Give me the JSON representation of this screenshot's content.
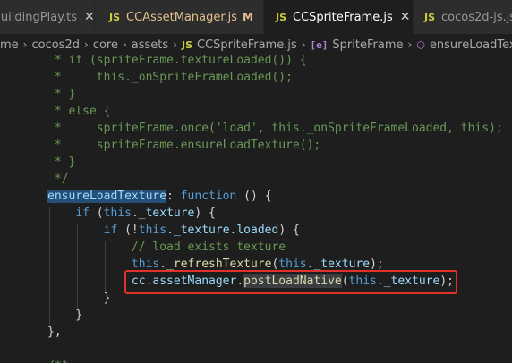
{
  "tabs": [
    {
      "icon": "TS",
      "icon_kind": "ts",
      "label": "BuildingPlay.ts",
      "closable": true,
      "active": false,
      "modified": false
    },
    {
      "icon": "JS",
      "icon_kind": "js",
      "label": "CCAssetManager.js",
      "mod_marker": "M",
      "active": false,
      "modified": true
    },
    {
      "icon": "JS",
      "icon_kind": "js",
      "label": "CCSpriteFrame.js",
      "closable": true,
      "active": true,
      "modified": false
    },
    {
      "icon": "JS",
      "icon_kind": "js",
      "label": "cocos2d-js.js",
      "active": false,
      "modified": false
    }
  ],
  "breadcrumb": {
    "items": [
      "me",
      "cocos2d",
      "core",
      "assets",
      "CCSpriteFrame.js",
      "SpriteFrame",
      "ensureLoadTexture"
    ],
    "file_icon": "JS",
    "class_icon": "[e]",
    "method_icon": "⬡"
  },
  "code_lines": [
    [
      [
        "c",
        " * if (spriteFrame.textureLoaded()) {"
      ]
    ],
    [
      [
        "c",
        " *     this._onSpriteFrameLoaded();"
      ]
    ],
    [
      [
        "c",
        " * }"
      ]
    ],
    [
      [
        "c",
        " * else {"
      ]
    ],
    [
      [
        "c",
        " *     spriteFrame.once('load', this._onSpriteFrameLoaded, this);"
      ]
    ],
    [
      [
        "c",
        " *     spriteFrame.ensureLoadTexture();"
      ]
    ],
    [
      [
        "c",
        " * }"
      ]
    ],
    [
      [
        "c",
        " */"
      ]
    ],
    [
      [
        "v",
        "ensureLoadTexture"
      ],
      [
        "p",
        ": "
      ],
      [
        "k",
        "function"
      ],
      [
        "p",
        " () {"
      ]
    ],
    [
      [
        "p",
        "    "
      ],
      [
        "k",
        "if"
      ],
      [
        "p",
        " ("
      ],
      [
        "k",
        "this"
      ],
      [
        "p",
        "."
      ],
      [
        "v",
        "_texture"
      ],
      [
        "p",
        ") {"
      ]
    ],
    [
      [
        "p",
        "        "
      ],
      [
        "k",
        "if"
      ],
      [
        "p",
        " (!"
      ],
      [
        "k",
        "this"
      ],
      [
        "p",
        "."
      ],
      [
        "v",
        "_texture"
      ],
      [
        "p",
        "."
      ],
      [
        "v",
        "loaded"
      ],
      [
        "p",
        ") {"
      ]
    ],
    [
      [
        "p",
        "            "
      ],
      [
        "c",
        "// load exists texture"
      ]
    ],
    [
      [
        "p",
        "            "
      ],
      [
        "k",
        "this"
      ],
      [
        "p",
        "."
      ],
      [
        "f",
        "_refreshTexture"
      ],
      [
        "p",
        "("
      ],
      [
        "k",
        "this"
      ],
      [
        "p",
        "."
      ],
      [
        "v",
        "_texture"
      ],
      [
        "p",
        ");"
      ]
    ],
    [
      [
        "p",
        "            "
      ],
      [
        "v",
        "cc"
      ],
      [
        "p",
        "."
      ],
      [
        "v",
        "assetManager"
      ],
      [
        "p",
        "."
      ],
      [
        "f",
        "postLoadNative"
      ],
      [
        "p",
        "("
      ],
      [
        "k",
        "this"
      ],
      [
        "p",
        "."
      ],
      [
        "v",
        "_texture"
      ],
      [
        "p",
        ");"
      ]
    ],
    [
      [
        "p",
        "        }"
      ]
    ],
    [
      [
        "p",
        "    }"
      ]
    ],
    [
      [
        "p",
        "},"
      ]
    ],
    [
      [
        "p",
        ""
      ]
    ],
    [
      [
        "c",
        "/**"
      ]
    ]
  ]
}
